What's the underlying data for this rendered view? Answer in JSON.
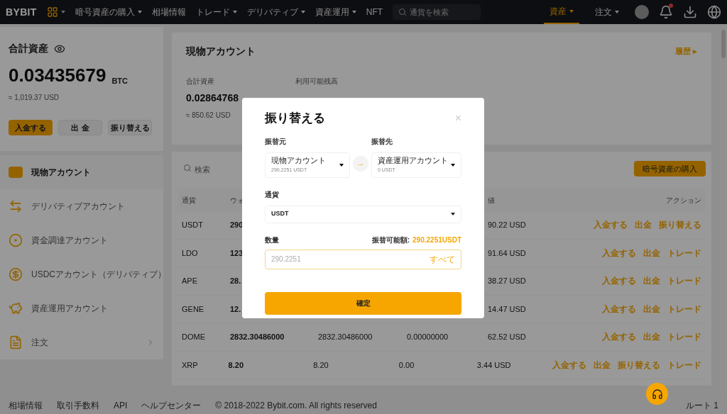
{
  "topbar": {
    "logo": "BYBIT",
    "menu": [
      {
        "label": "暗号資産の購入",
        "caret": true
      },
      {
        "label": "相場情報",
        "caret": false
      },
      {
        "label": "トレード",
        "caret": true
      },
      {
        "label": "デリバティブ",
        "caret": true
      },
      {
        "label": "資産運用",
        "caret": true
      },
      {
        "label": "NFT",
        "caret": false
      }
    ],
    "search": {
      "placeholder": "通貨を検索"
    },
    "right_menu": [
      {
        "label": "資産",
        "selected": true
      },
      {
        "label": "注文",
        "selected": false
      }
    ],
    "notification_dot": true
  },
  "sidebar": {
    "title": "合計資産",
    "balance": "0.03435679",
    "unit": "BTC",
    "usd": "≈ 1,019.37 USD",
    "buttons": [
      {
        "label": "入金する",
        "primary": true
      },
      {
        "label": "出 金",
        "primary": false
      },
      {
        "label": "振り替える",
        "primary": false
      }
    ],
    "items": [
      {
        "label": "現物アカウント",
        "selected": true,
        "chevron": false
      },
      {
        "label": "デリバティブアカウント",
        "selected": false,
        "chevron": false
      },
      {
        "label": "資金調達アカウント",
        "selected": false,
        "chevron": false
      },
      {
        "label": "USDCアカウント（デリバティブ）",
        "selected": false,
        "chevron": false
      },
      {
        "label": "資産運用アカウント",
        "selected": false,
        "chevron": false
      },
      {
        "label": "注文",
        "selected": false,
        "chevron": true
      }
    ]
  },
  "account": {
    "title": "現物アカウント",
    "history_link": "履歴",
    "history_arrow": "▸",
    "stats": [
      {
        "label": "合計資産",
        "value": "0.02864768",
        "usd": "≈ 850.62 USD"
      },
      {
        "label": "利用可能残高"
      }
    ]
  },
  "table": {
    "search": {
      "placeholder": "検索"
    },
    "buy_button": "暗号資産の購入",
    "columns": [
      "通貨",
      "ウォ",
      "",
      "",
      "値",
      "アクション"
    ],
    "rows": [
      {
        "cells": [
          "USDT",
          "290",
          "",
          "",
          "90.22 USD"
        ],
        "actions": [
          "入金する",
          "出金",
          "振り替える"
        ]
      },
      {
        "cells": [
          "LDO",
          "123",
          "",
          "",
          "91.64 USD"
        ],
        "actions": [
          "入金する",
          "出金",
          "トレード"
        ]
      },
      {
        "cells": [
          "APE",
          "28.",
          "",
          "",
          "38.27 USD"
        ],
        "actions": [
          "入金する",
          "出金",
          "トレード"
        ]
      },
      {
        "cells": [
          "GENE",
          "12.",
          "",
          "",
          "14.47 USD"
        ],
        "actions": [
          "入金する",
          "出金",
          "トレード"
        ]
      },
      {
        "cells": [
          "DOME",
          "2832.30486000",
          "2832.30486000",
          "0.00000000",
          "62.52 USD"
        ],
        "actions": [
          "入金する",
          "出金",
          "トレード"
        ]
      },
      {
        "cells": [
          "XRP",
          "8.20",
          "8.20",
          "0.00",
          "3.44 USD"
        ],
        "actions": [
          "入金する",
          "出金",
          "振り替える",
          "トレード"
        ]
      }
    ]
  },
  "footer": {
    "links": [
      "相場情報",
      "取引手数料",
      "API",
      "ヘルプセンター"
    ],
    "copyright": "© 2018-2022 Bybit.com. All rights reserved",
    "route": "ルート 1"
  },
  "modal": {
    "title": "振り替える",
    "close": "×",
    "swap_arrow": "→",
    "from": {
      "label": "振替元",
      "account": "現物アカウント",
      "balance": "290.2251 USDT"
    },
    "to": {
      "label": "振替先",
      "account": "資産運用アカウント",
      "balance": "0 USDT"
    },
    "currency": {
      "label": "通貨",
      "value": "USDT"
    },
    "amount": {
      "label": "数量",
      "available_label": "振替可能額:",
      "available_value": "290.2251USDT",
      "placeholder": "290.2251",
      "all": "すべて"
    },
    "confirm": "確定"
  }
}
